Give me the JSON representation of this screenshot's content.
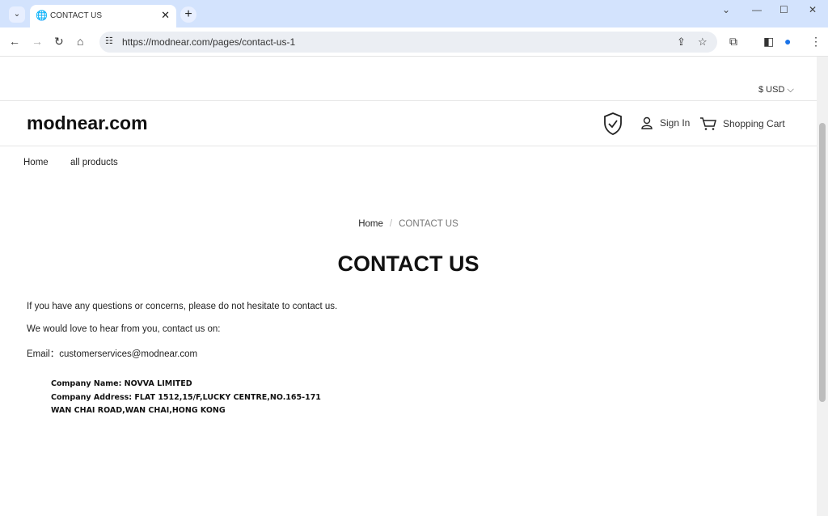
{
  "browser": {
    "tab_title": "CONTACT US",
    "url": "https://modnear.com/pages/contact-us-1"
  },
  "header": {
    "currency": "$ USD",
    "logo": "modnear.com",
    "sign_in": "Sign In",
    "cart": "Shopping Cart"
  },
  "menu": [
    {
      "label": "Home"
    },
    {
      "label": "all products"
    }
  ],
  "breadcrumb": {
    "home": "Home",
    "separator": "/",
    "current": "CONTACT US"
  },
  "page": {
    "title": "CONTACT US",
    "lines": [
      "If you have any questions or concerns, please do not hesitate to contact us.",
      "We would love to hear from you, contact us on:",
      "Email：customerservices@modnear.com"
    ],
    "company": [
      "Company Name: NOVVA LIMITED",
      "Company Address: FLAT 1512,15/F,LUCKY CENTRE,NO.165-171",
      "WAN CHAI ROAD,WAN CHAI,HONG KONG"
    ]
  }
}
